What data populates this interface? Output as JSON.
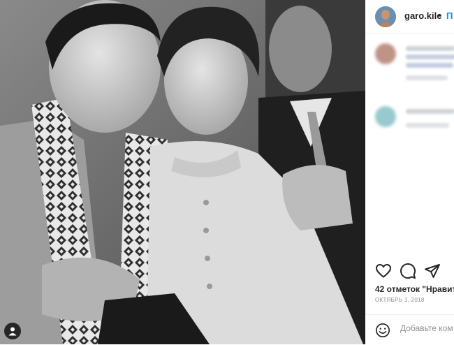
{
  "post": {
    "username": "garo.kile",
    "separator": "•",
    "follow_label": "П",
    "likes_text": "42 отметок \"Нравит",
    "date_text": "ОКТЯБРЬ 1, 2018",
    "comment_placeholder": "Добавьте ком"
  },
  "icons": {
    "like": "heart-icon",
    "comment": "comment-icon",
    "share": "share-icon",
    "emoji": "emoji-icon",
    "tagged_user": "user-tag-icon"
  },
  "colors": {
    "link_blue": "#0095f6",
    "text": "#262626",
    "muted": "#8e8e8e"
  }
}
